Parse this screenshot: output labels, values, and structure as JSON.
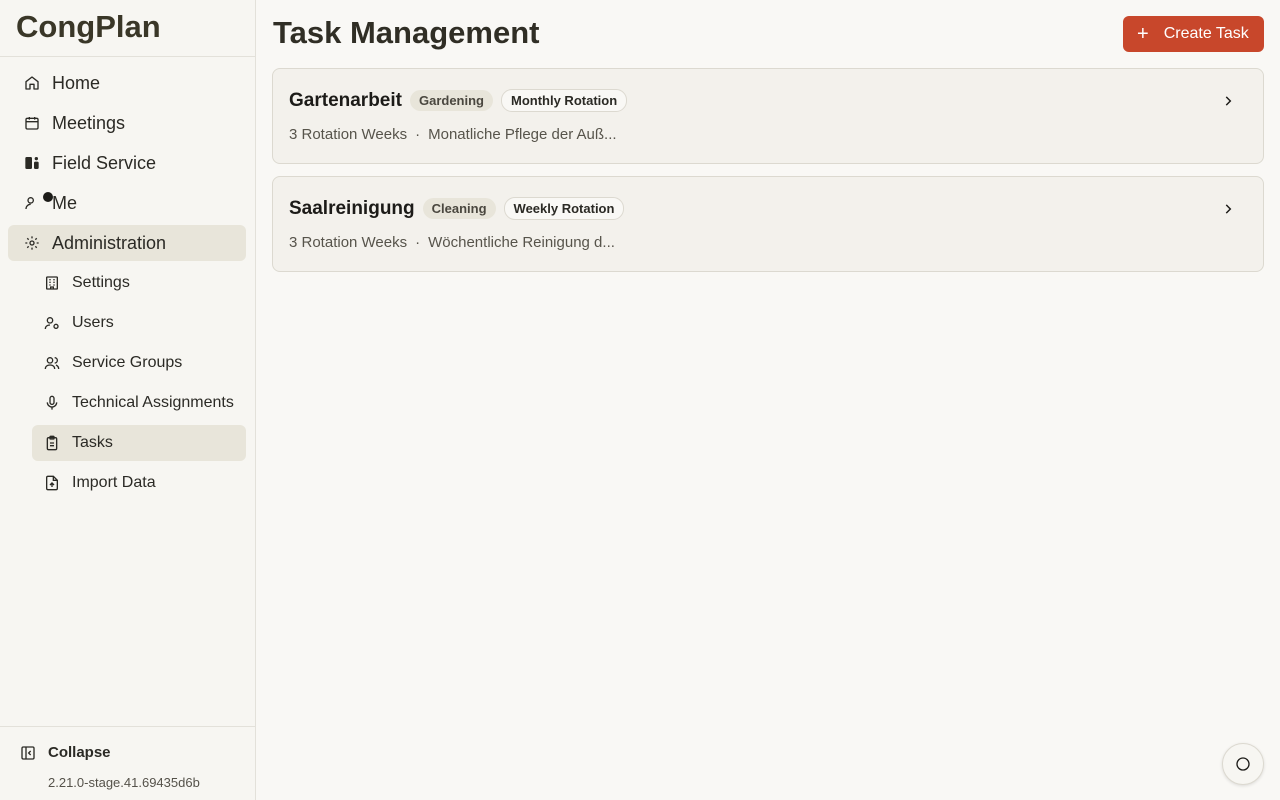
{
  "app": {
    "name": "CongPlan",
    "version": "2.21.0-stage.41.69435d6b"
  },
  "sidebar": {
    "items": [
      {
        "label": "Home",
        "icon": "home-icon"
      },
      {
        "label": "Meetings",
        "icon": "calendar-icon"
      },
      {
        "label": "Field Service",
        "icon": "field-service-icon"
      },
      {
        "label": "Me",
        "icon": "user-icon"
      },
      {
        "label": "Administration",
        "icon": "gear-icon"
      }
    ],
    "subitems": [
      {
        "label": "Settings",
        "icon": "building-icon"
      },
      {
        "label": "Users",
        "icon": "user-cog-icon"
      },
      {
        "label": "Service Groups",
        "icon": "users-icon"
      },
      {
        "label": "Technical Assignments",
        "icon": "microphone-icon"
      },
      {
        "label": "Tasks",
        "icon": "clipboard-icon"
      },
      {
        "label": "Import Data",
        "icon": "file-upload-icon"
      }
    ],
    "collapse_label": "Collapse"
  },
  "main": {
    "title": "Task Management",
    "create_button": "Create Task",
    "tasks": [
      {
        "title": "Gartenarbeit",
        "category": "Gardening",
        "rotation": "Monthly Rotation",
        "weeks": "3 Rotation Weeks",
        "separator": "·",
        "description": "Monatliche Pflege der Auß..."
      },
      {
        "title": "Saalreinigung",
        "category": "Cleaning",
        "rotation": "Weekly Rotation",
        "weeks": "3 Rotation Weeks",
        "separator": "·",
        "description": "Wöchentliche Reinigung d..."
      }
    ]
  },
  "colors": {
    "accent": "#c8472b",
    "active_bg": "#e8e5da",
    "background": "#f9f8f5"
  }
}
